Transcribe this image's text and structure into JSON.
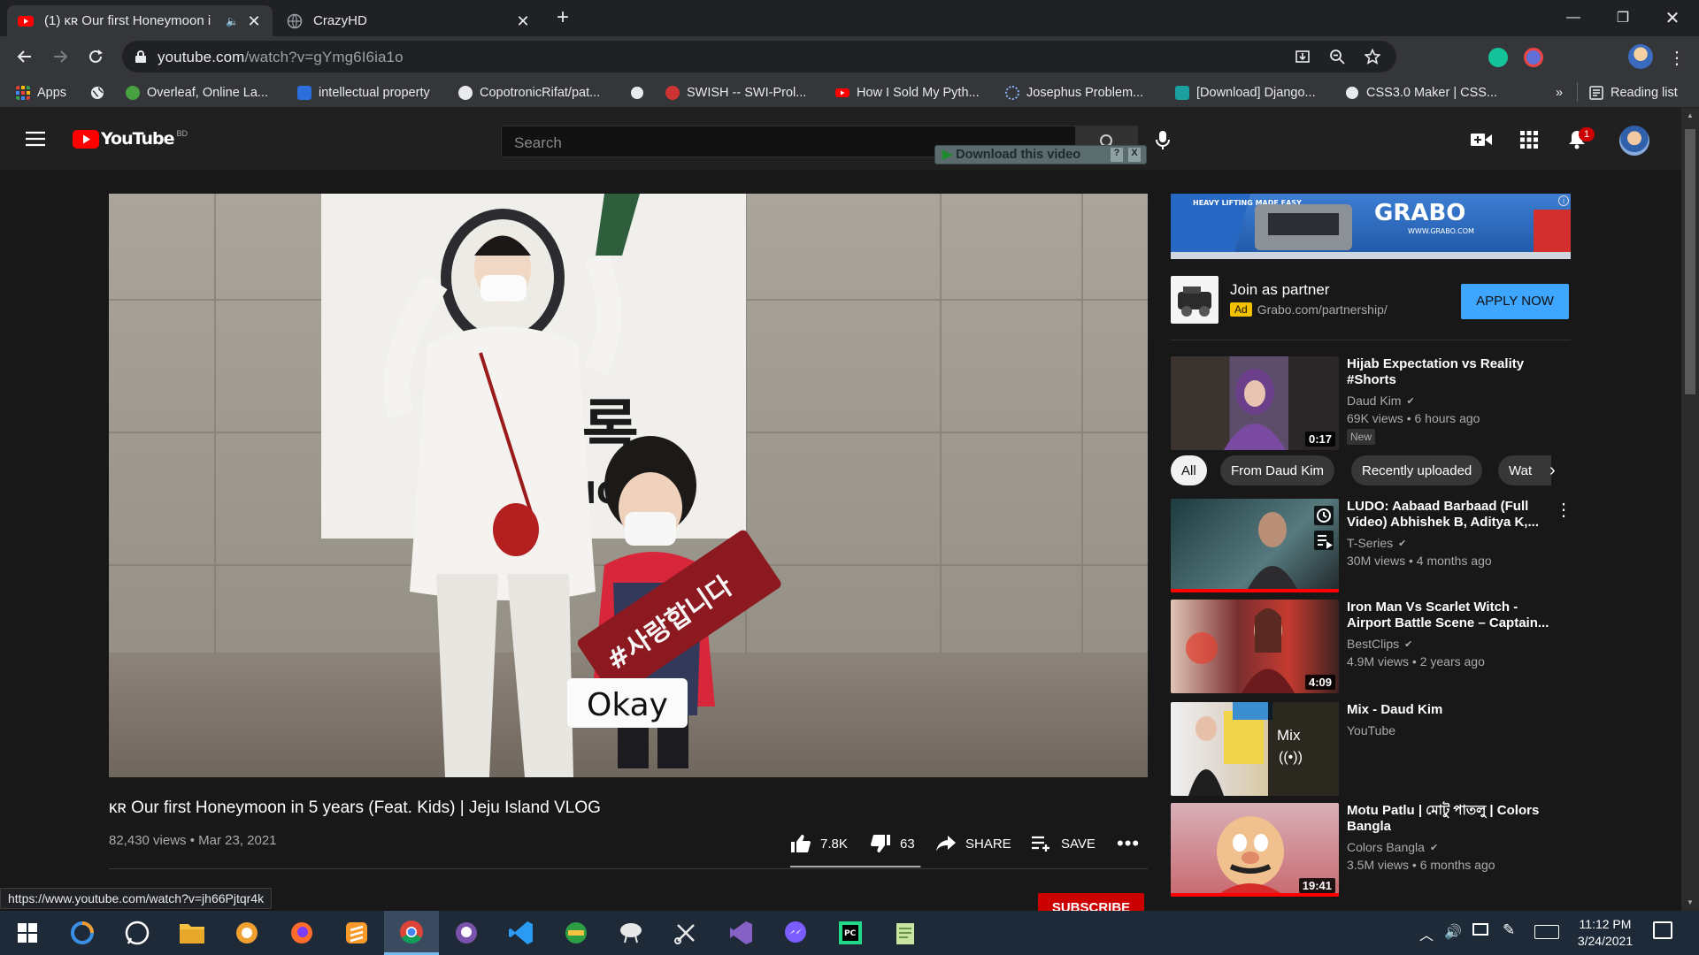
{
  "browser": {
    "tabs": [
      {
        "title": "(1) ᴋʀ Our first Honeymoon i",
        "active": true
      },
      {
        "title": "CrazyHD",
        "active": false
      }
    ],
    "url_host": "youtube.com",
    "url_path": "/watch?v=gYmg6I6ia1o",
    "bookmarks": [
      "Apps",
      "Overleaf, Online La...",
      "intellectual property",
      "CopotronicRifat/pat...",
      "SWISH -- SWI-Prol...",
      "How I Sold My Pyth...",
      "Josephus Problem...",
      "[Download] Django...",
      "CSS3.0 Maker | CSS..."
    ],
    "overflow": "»",
    "reading_list": "Reading list",
    "status_url": "https://www.youtube.com/watch?v=jh66Pjtqr4k"
  },
  "youtube": {
    "logo_text": "YouTube",
    "region": "BD",
    "search_placeholder": "Search",
    "download_bar": "Download this video",
    "download_help": "?",
    "download_close": "X",
    "notification_count": "1",
    "colors": {
      "accent": "#ff0000",
      "link": "#3ea6ff",
      "bg": "#181818",
      "header": "#202020"
    }
  },
  "video": {
    "caption": "Okay",
    "title": "ᴋʀ Our first Honeymoon in 5 years (Feat. Kids) | Jeju Island VLOG",
    "meta": "82,430 views • Mar 23, 2021",
    "likes": "7.8K",
    "dislikes": "63",
    "like_ratio": 0.992,
    "share": "SHARE",
    "save": "SAVE",
    "subscribe": "SUBSCRIBE"
  },
  "ad": {
    "banner_brand": "GRABO",
    "banner_site": "WWW.GRABO.COM",
    "banner_tag": "HEAVY LIFTING MADE EASY",
    "title": "Join as partner",
    "badge": "Ad",
    "url": "Grabo.com/partnership/",
    "cta": "APPLY NOW"
  },
  "chips": [
    "All",
    "From Daud Kim",
    "Recently uploaded",
    "Wat"
  ],
  "recommendations": [
    {
      "title": "Hijab Expectation vs Reality #Shorts",
      "channel": "Daud Kim",
      "stats": "69K views • 6 hours ago",
      "badge": "New",
      "duration": "0:17"
    },
    {
      "title": "LUDO: Aabaad Barbaad (Full Video) Abhishek B, Aditya K,...",
      "channel": "T-Series",
      "stats": "30M views • 4 months ago",
      "duration": ""
    },
    {
      "title": "Iron Man Vs Scarlet Witch - Airport Battle Scene – Captain...",
      "channel": "BestClips",
      "stats": "4.9M views • 2 years ago",
      "duration": "4:09"
    },
    {
      "title": "Mix - Daud Kim",
      "channel": "YouTube",
      "stats": "",
      "mix_label": "Mix"
    },
    {
      "title": "Motu Patlu | মোটু পাতলু | Colors Bangla",
      "channel": "Colors Bangla",
      "stats": "3.5M views • 6 months ago",
      "duration": "19:41"
    }
  ],
  "taskbar": {
    "time": "11:12 PM",
    "date": "3/24/2021"
  }
}
